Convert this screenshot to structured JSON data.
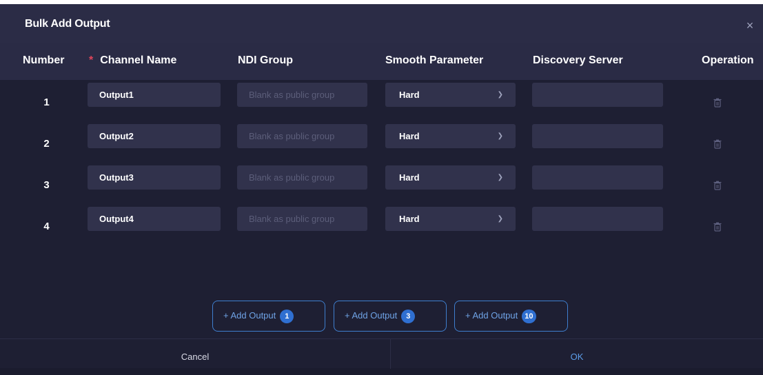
{
  "dialog": {
    "title": "Bulk Add Output",
    "close_icon": "×"
  },
  "columns": {
    "number": "Number",
    "required_mark": "*",
    "channel_name": "Channel Name",
    "ndi_group": "NDI Group",
    "smooth_parameter": "Smooth Parameter",
    "discovery_server": "Discovery Server",
    "operation": "Operation"
  },
  "rows": [
    {
      "number": "1",
      "channel_name": "Output1",
      "ndi_group_placeholder": "Blank as public group",
      "smooth": "Hard",
      "discovery_server": ""
    },
    {
      "number": "2",
      "channel_name": "Output2",
      "ndi_group_placeholder": "Blank as public group",
      "smooth": "Hard",
      "discovery_server": ""
    },
    {
      "number": "3",
      "channel_name": "Output3",
      "ndi_group_placeholder": "Blank as public group",
      "smooth": "Hard",
      "discovery_server": ""
    },
    {
      "number": "4",
      "channel_name": "Output4",
      "ndi_group_placeholder": "Blank as public group",
      "smooth": "Hard",
      "discovery_server": ""
    }
  ],
  "add_buttons": [
    {
      "label": "+ Add Output",
      "count": "1"
    },
    {
      "label": "+ Add Output",
      "count": "3"
    },
    {
      "label": "+ Add Output",
      "count": "10"
    }
  ],
  "footer": {
    "cancel": "Cancel",
    "ok": "OK"
  },
  "colors": {
    "accent": "#3f7fcf",
    "required": "#e0455a",
    "ok": "#5c9de8"
  },
  "icons": {
    "close": "close-icon",
    "dropdown": "chevron-down-icon",
    "delete": "trash-icon"
  }
}
